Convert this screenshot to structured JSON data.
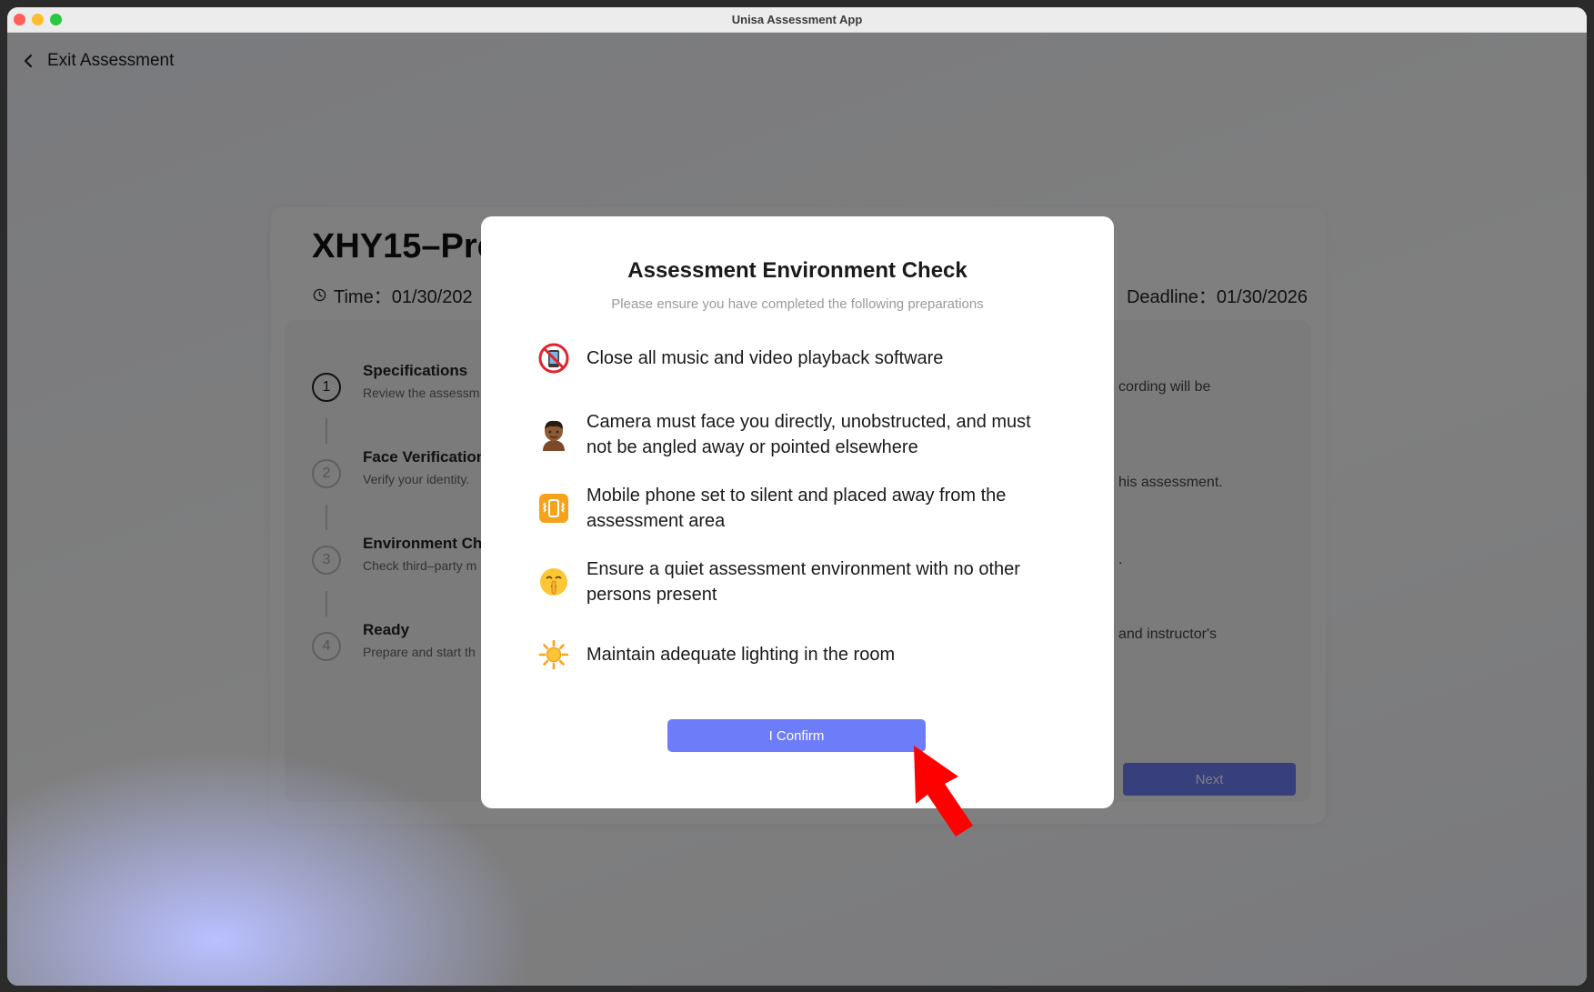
{
  "window": {
    "title": "Unisa Assessment App"
  },
  "header": {
    "exit_label": "Exit Assessment"
  },
  "exam": {
    "title": "XHY15–Pre",
    "time": "Time：01/30/202",
    "deadline": "Deadline：01/30/2026"
  },
  "steps": [
    {
      "number": "1",
      "title": "Specifications",
      "desc": "Review the assessm"
    },
    {
      "number": "2",
      "title": "Face Verification",
      "desc": "Verify your identity."
    },
    {
      "number": "3",
      "title": "Environment Che",
      "desc": "Check third–party m"
    },
    {
      "number": "4",
      "title": "Ready",
      "desc": "Prepare and start th"
    }
  ],
  "right_panel": {
    "frag1": "cording will be",
    "frag2": "his assessment.",
    "frag3": ".",
    "frag4": "and instructor's",
    "next_label": "Next"
  },
  "modal": {
    "title": "Assessment Environment Check",
    "subtitle": "Please ensure you have completed the following preparations",
    "items": [
      {
        "icon": "no-phone-icon",
        "text": "Close all music and video playback software"
      },
      {
        "icon": "person-icon",
        "text": "Camera must face you directly, unobstructed, and must not be angled away or pointed elsewhere"
      },
      {
        "icon": "vibrate-mode-icon",
        "text": "Mobile phone set to silent and placed away from the assessment area"
      },
      {
        "icon": "shushing-face-icon",
        "text": "Ensure a quiet assessment environment with no other persons present"
      },
      {
        "icon": "sun-icon",
        "text": "Maintain adequate lighting in the room"
      }
    ],
    "confirm_label": "I Confirm"
  },
  "colors": {
    "accent": "#6d7dfa",
    "arrow": "#ff0000",
    "overlay": "rgba(0,0,0,0.5)"
  }
}
